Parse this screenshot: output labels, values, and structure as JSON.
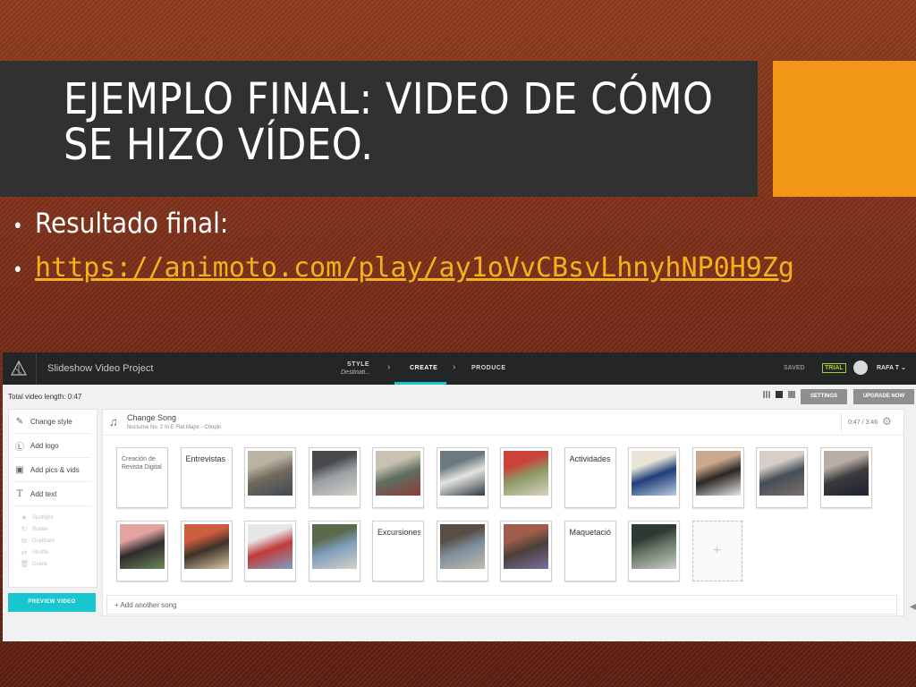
{
  "slide": {
    "title": "EJEMPLO FINAL: VIDEO DE CÓMO SE HIZO VÍDEO.",
    "bullets": [
      {
        "text": "Resultado final:",
        "is_link": false
      },
      {
        "text": "https://animoto.com/play/ay1oVvCBsvLhnyhNP0H9Zg",
        "is_link": true
      }
    ],
    "colors": {
      "title_band": "#303131",
      "accent": "#f29618",
      "link": "#f6b11a",
      "background": "#6e2818"
    }
  },
  "app": {
    "project_title": "Slideshow Video Project",
    "steps": [
      {
        "label": "STYLE",
        "sub": "Destinati..."
      },
      {
        "label": "CREATE",
        "sub": ""
      },
      {
        "label": "PRODUCE",
        "sub": ""
      }
    ],
    "active_step": "CREATE",
    "saved_label": "SAVED",
    "trial_label": "TRIAL",
    "user_label": "RAFA T",
    "total_length": "Total video length: 0:47",
    "settings_label": "SETTINGS",
    "upgrade_label": "UPGRADE NOW",
    "sidebar": {
      "primary": [
        {
          "label": "Change style",
          "icon": "brush-icon"
        },
        {
          "label": "Add logo",
          "icon": "logo-icon"
        },
        {
          "label": "Add pics & vids",
          "icon": "media-icon"
        },
        {
          "label": "Add text",
          "icon": "text-icon"
        }
      ],
      "secondary": [
        {
          "label": "Spotlight",
          "icon": "star-icon"
        },
        {
          "label": "Rotate",
          "icon": "rotate-icon"
        },
        {
          "label": "Duplicate",
          "icon": "duplicate-icon"
        },
        {
          "label": "Shuffle",
          "icon": "shuffle-icon"
        },
        {
          "label": "Delete",
          "icon": "trash-icon"
        }
      ]
    },
    "preview_label": "PREVIEW VIDEO",
    "song": {
      "change_label": "Change Song",
      "name": "Nocturne No. 2 In E Flat Major - Chopin",
      "time": "0:47 / 3:46"
    },
    "tiles_row1": [
      {
        "type": "text",
        "text": "Creación de Revista Digital"
      },
      {
        "type": "text",
        "text": "Entrevistas"
      },
      {
        "type": "photo",
        "colors": [
          "#6f6a5c",
          "#b9b3a3",
          "#3f4a55"
        ]
      },
      {
        "type": "photo",
        "colors": [
          "#9aa2a6",
          "#4a4a4e",
          "#d2cfc8"
        ]
      },
      {
        "type": "photo",
        "colors": [
          "#5e6f62",
          "#c9c1b1",
          "#8e3a3a"
        ]
      },
      {
        "type": "photo",
        "colors": [
          "#e4e4e0",
          "#6b7a80",
          "#2f3a44"
        ]
      },
      {
        "type": "photo",
        "colors": [
          "#8e9a64",
          "#c9433b",
          "#d8d3c2"
        ]
      },
      {
        "type": "text",
        "text": "Actividades"
      },
      {
        "type": "photo",
        "colors": [
          "#1f3f7a",
          "#e8e4d6",
          "#b8c9dd"
        ]
      },
      {
        "type": "photo",
        "colors": [
          "#2c2622",
          "#c9a88e",
          "#e6e6e6"
        ]
      },
      {
        "type": "photo",
        "colors": [
          "#454e58",
          "#d6cfc9",
          "#7c6f69"
        ]
      },
      {
        "type": "photo",
        "colors": [
          "#3c3b3c",
          "#b9aea5",
          "#1d2230"
        ]
      }
    ],
    "tiles_row2": [
      {
        "type": "photo",
        "colors": [
          "#2d2b2c",
          "#e2a3a3",
          "#6f8a5a"
        ]
      },
      {
        "type": "photo",
        "colors": [
          "#3d3228",
          "#cc5d3f",
          "#d9c7a6"
        ]
      },
      {
        "type": "photo",
        "colors": [
          "#c13b3b",
          "#e6e6e6",
          "#7ea0c2"
        ]
      },
      {
        "type": "photo",
        "colors": [
          "#7f9fbf",
          "#5b6a4c",
          "#d9d1c5"
        ]
      },
      {
        "type": "text",
        "text": "Excursiones"
      },
      {
        "type": "photo",
        "colors": [
          "#7c8f9e",
          "#5a4d43",
          "#c3b9ad"
        ]
      },
      {
        "type": "photo",
        "colors": [
          "#4b3f3a",
          "#a05d4b",
          "#7a6fa0"
        ]
      },
      {
        "type": "text",
        "text": "Maquetació"
      },
      {
        "type": "photo",
        "colors": [
          "#6c7b6a",
          "#2c3a33",
          "#c7cfc8"
        ]
      }
    ],
    "add_tile_symbol": "+",
    "add_song_label": "+ Add another song"
  }
}
